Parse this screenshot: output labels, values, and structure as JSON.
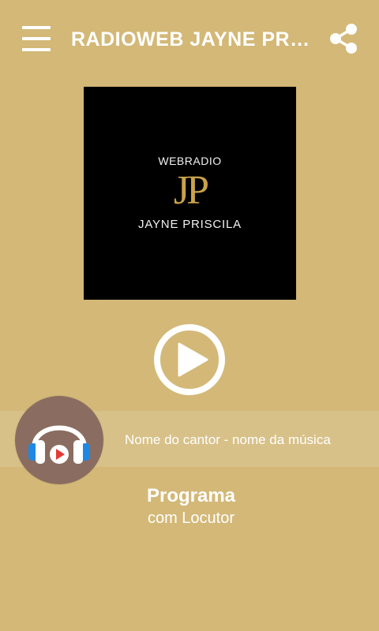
{
  "header": {
    "title": "RADIOWEB JAYNE PRISCILA",
    "menu_icon": "hamburger-menu-icon",
    "share_icon": "share-icon"
  },
  "logo": {
    "top_text": "WEBRADIO",
    "monogram": "JP",
    "brand_text": "JAYNE PRISCILA"
  },
  "player": {
    "play_icon": "play-icon",
    "now_playing": "Nome do cantor - nome da música"
  },
  "program": {
    "name": "Programa",
    "host": "com Locutor"
  },
  "colors": {
    "background": "#d3b877",
    "avatar_bg": "#8a6d60",
    "headphone_blue": "#1e88e5",
    "play_red": "#e53935",
    "logo_gold": "#c9a24a"
  }
}
